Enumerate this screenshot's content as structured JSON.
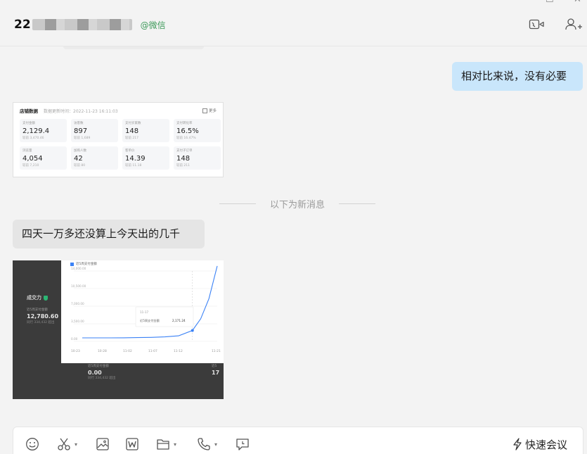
{
  "window": {
    "min_glyph": "—",
    "max_glyph": "☐",
    "close_glyph": "✕"
  },
  "header": {
    "contact_name": "22",
    "contact_source": "@微信",
    "icons": [
      "video-call-icon",
      "add-member-icon"
    ]
  },
  "messages": {
    "outgoing_1": "相对比来说，没有必要",
    "divider": "以下为新消息",
    "incoming_1": "四天一万多还没算上今天出的几千"
  },
  "dashboard_image": {
    "title": "店铺数据",
    "subtitle": "数据更新时间：2022-11-23 16:11:03",
    "more": "更多",
    "stats": [
      {
        "label": "支付金额",
        "value": "2,129.4",
        "sub": "较前 3,470.46"
      },
      {
        "label": "访客数",
        "value": "897",
        "sub": "较前 1,689"
      },
      {
        "label": "支付买家数",
        "value": "148",
        "sub": "较前 217"
      },
      {
        "label": "支付转化率",
        "value": "16.5%",
        "sub": "较前 16.47%"
      },
      {
        "label": "浏览量",
        "value": "4,054",
        "sub": "较前 7,210"
      },
      {
        "label": "加购人数",
        "value": "42",
        "sub": "较前 80"
      },
      {
        "label": "客单价",
        "value": "14.39",
        "sub": "较前 11.18"
      },
      {
        "label": "支付子订单",
        "value": "148",
        "sub": "较前 211"
      }
    ]
  },
  "chart_image": {
    "side_title": "成交力",
    "side_label": "近5周支付金额",
    "side_value": "12,780.60",
    "side_sub": "同行 334,432 超出",
    "bottom_label": "近5周支付金额",
    "bottom_value": "0.00",
    "bottom_sub": "同行 334,432 超出",
    "bottom_label_2": "近5",
    "bottom_value_2": "17",
    "tooltip_date": "11-17",
    "tooltip_label": "近5周支付金额",
    "tooltip_value": "2,171.24"
  },
  "chart_data": {
    "type": "line",
    "series": [
      {
        "name": "近5周支付金额",
        "values": [
          700,
          700,
          700,
          720,
          760,
          800,
          900,
          1100,
          2171.24,
          4500,
          8500,
          15000
        ]
      }
    ],
    "x": [
      0,
      5,
      10,
      15,
      20,
      25,
      30,
      35,
      40,
      43,
      46,
      49
    ],
    "x_tick_labels": [
      "10-23",
      "10-28",
      "11-02",
      "11-07",
      "11-12",
      "11-21"
    ],
    "y_tick_labels": [
      "14,000.00",
      "10,500.00",
      "7,000.00",
      "3,500.00",
      "0.00"
    ],
    "ylim": [
      0,
      14000
    ],
    "legend_position": "top-left",
    "grid": true
  },
  "toolbar": {
    "meeting_label": "快速会议",
    "caret": "▾"
  },
  "colors": {
    "outgoing_bubble": "#c9e6fb",
    "incoming_bubble": "#e5e5e5",
    "source_green": "#3d9a5a",
    "line_blue": "#3b82f6"
  }
}
